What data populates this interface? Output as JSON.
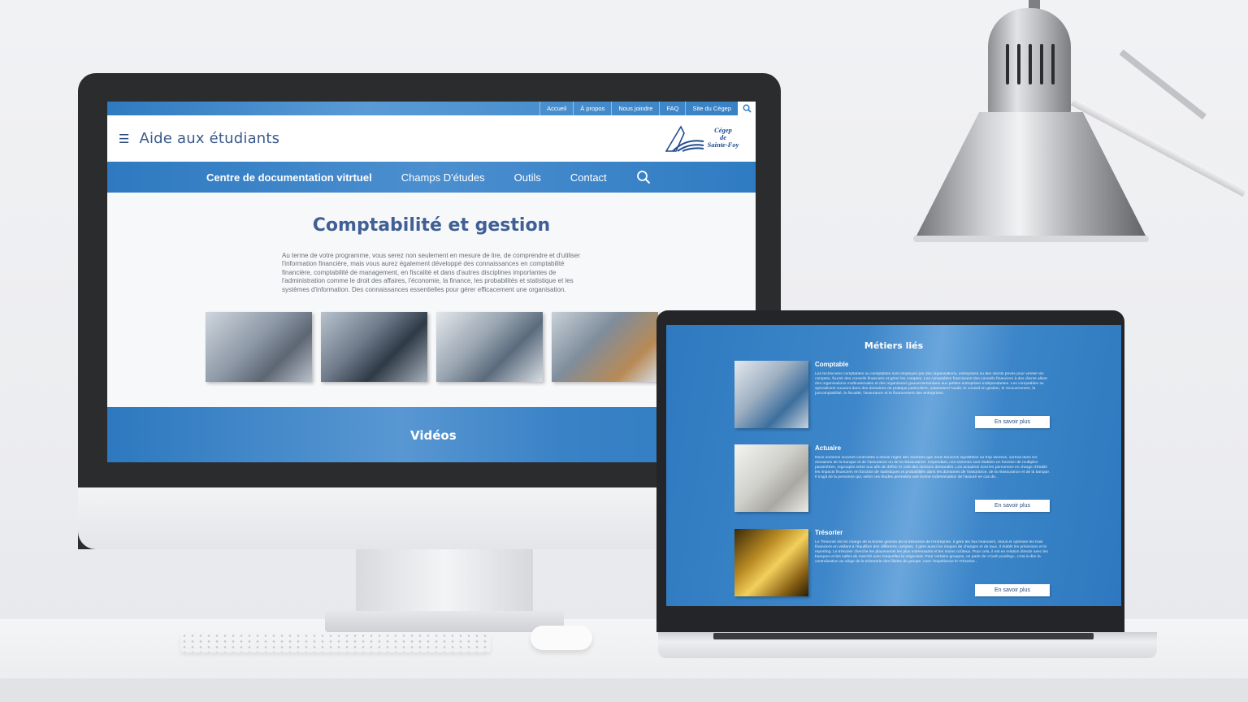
{
  "desktop_site": {
    "topbar_links": [
      "Accueil",
      "À propos",
      "Nous joindre",
      "FAQ",
      "Site du Cégep"
    ],
    "site_title": "Aide aux étudiants",
    "logo_text": [
      "Cégep",
      "de",
      "Sainte-Foy"
    ],
    "main_nav": [
      "Centre de documentation vitrtuel",
      "Champs D'études",
      "Outils",
      "Contact"
    ],
    "page_title": "Comptabilité et gestion",
    "intro": "Au terme de votre programme, vous serez non seulement en mesure de lire, de comprendre et d'utiliser l'information financière, mais vous aurez également développé des connaissances en comptabilité financière, comptabilité de management, en fiscalité et dans d'autres disciplines importantes de l'administration comme le droit des affaires, l'économie, la finance, les probabilités et statistique et les systèmes d'information. Des connaissances essentielles pour gérer efficacement une organisation.",
    "videos_label": "Vidéos"
  },
  "laptop_site": {
    "section_title": "Métiers liés",
    "jobs": [
      {
        "name": "Comptable",
        "description": "Les techniciens comptables ou comptables sont employés par des organisations, entreprises ou des clients privés pour vérifier les comptes, fournir des conseils financiers et gérer les comptes. Les comptables fournissent des conseils financiers à des clients allant des organisations multinationales et des organismes gouvernementaux aux petites entreprises indépendantes. Les comptables se spécialisent souvent dans des domaines de pratique particuliers, notamment l'audit, le conseil en gestion, le recouvrement, la juricomptabilité, la fiscalité, l'assurance et le financement des entreprises.",
        "button": "En savoir plus"
      },
      {
        "name": "Actuaire",
        "description": "Nous sommes souvent confrontés à devoir régler des sommes que nous trouvons injustifiées ou trop élevées, surtout dans les domaines de la banque et de l'assurance ou de la réassurance. Cependant, ces sommes sont établies en fonction de multiples paramètres, regroupés entre eux afin de définir le coût des services demandés. Les actuaires sont les personnes en charge d'établir les impacts financiers en fonction de statistiques et probabilités dans les domaines de l'assurance, de la réassurance et de la banque. Il s'agit de la personne qui, selon ces études permettra une bonne indemnisation de l'assuré en cas de...",
        "button": "En savoir plus"
      },
      {
        "name": "Trésorier",
        "description": "Le Trésorier est en charge de la bonne gestion de la trésorerie de l'entreprise. Il gère les flux financiers, réduit et optimise les frais financiers en veillant à l'équilibre des différents comptes. Il gère aussi les risques de changes et de taux. Il établit les prévisions et le reporting. Le trésorier cherche les placements les plus intéressants et les moins coûteux. Pour cela, il est en relation directe avec les banques et les salles de marché avec lesquelles la négociant. Pour certains groupes, on parle de «Cash pooling», c'est-à-dire la centralisation au siège de la trésorerie des filiales du groupe. Avec l'expérience le Trésorier...",
        "button": "En savoir plus"
      }
    ]
  },
  "colors": {
    "brand_blue": "#2e79c0",
    "title_blue": "#3f5f95",
    "monitor_bezel": "#2b2c2e"
  },
  "icons": [
    "menu-icon",
    "search-icon",
    "cegep-logo"
  ]
}
